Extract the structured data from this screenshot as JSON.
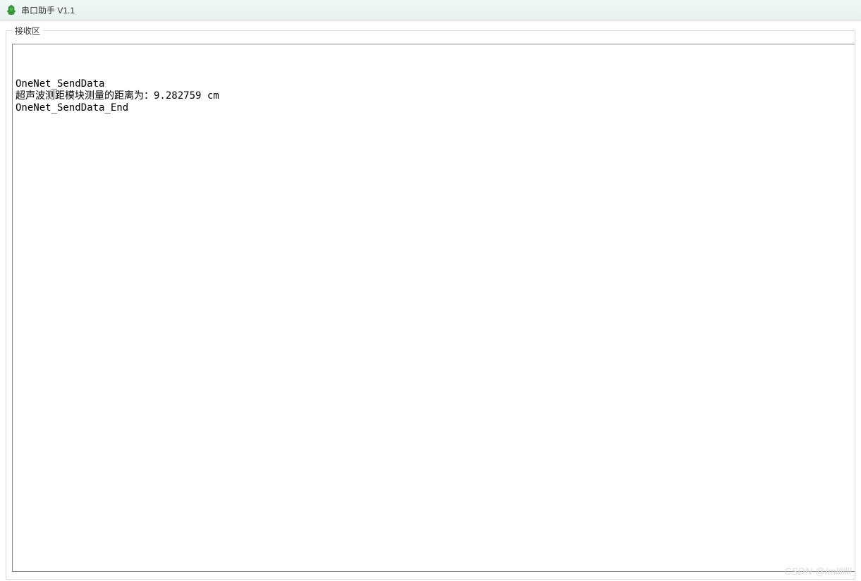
{
  "window": {
    "title": "串口助手 V1.1"
  },
  "groupbox": {
    "label": "接收区"
  },
  "receive": {
    "content": "OneNet_SendData\n超声波测距模块测量的距离为：9.282759 cm\nOneNet_SendData_End"
  },
  "watermark": {
    "text": "CSDN @Imlllllll_"
  }
}
